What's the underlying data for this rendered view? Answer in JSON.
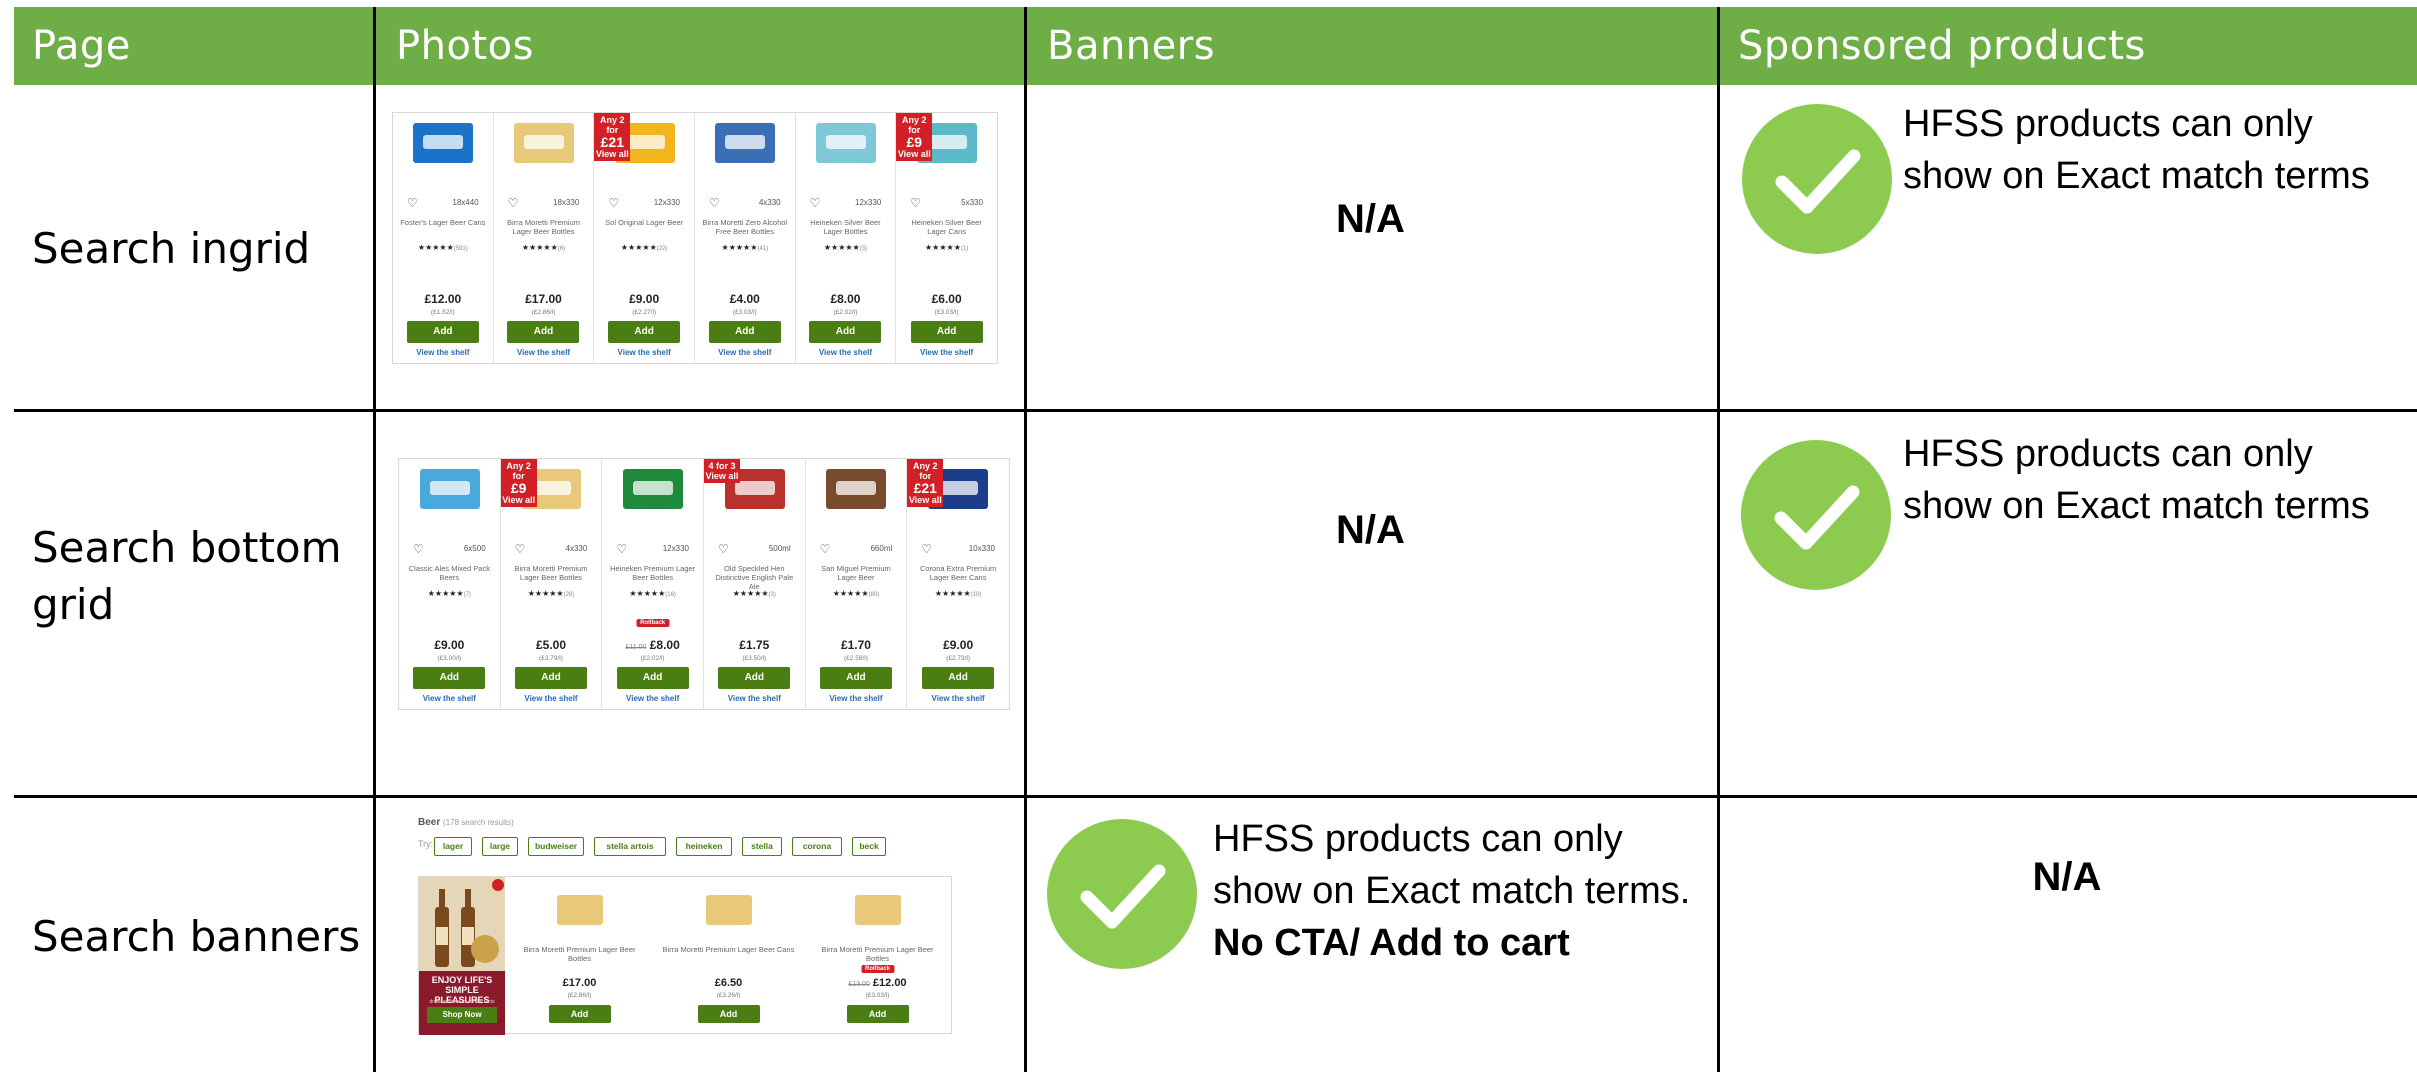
{
  "header": {
    "page": "Page",
    "photos": "Photos",
    "banners": "Banners",
    "sponsored": "Sponsored products"
  },
  "rows": {
    "r1": {
      "label": "Search ingrid",
      "banners": "N/A",
      "sponsored": "HFSS products can only show on Exact match terms"
    },
    "r2": {
      "label": "Search bottom grid",
      "banners": "N/A",
      "sponsored": "HFSS products can only show on Exact match terms"
    },
    "r3": {
      "label": "Search banners",
      "banners_line1": "HFSS products can only show on Exact match terms.",
      "banners_bold": "No CTA/ Add to cart",
      "sponsored": "N/A"
    }
  },
  "grid1": {
    "products": [
      {
        "name": "Foster's Lager Beer Cans",
        "size": "18x440",
        "reviews": "(591)",
        "price": "£12.00",
        "unit": "(£1.52/l)",
        "deal": "",
        "pack_color": "#1a73c9"
      },
      {
        "name": "Birra Moretti Premium Lager Beer Bottles",
        "size": "18x330",
        "reviews": "(6)",
        "price": "£17.00",
        "unit": "(£2.86/l)",
        "deal": "",
        "pack_color": "#e8c97a"
      },
      {
        "name": "Sol Original Lager Beer",
        "size": "12x330",
        "reviews": "(22)",
        "price": "£9.00",
        "unit": "(£2.27/l)",
        "deal": "Any 2 for|£21|View all",
        "pack_color": "#f2b51c"
      },
      {
        "name": "Birra Moretti Zero Alcohol Free Beer Bottles",
        "size": "4x330",
        "reviews": "(41)",
        "price": "£4.00",
        "unit": "(£3.03/l)",
        "deal": "",
        "pack_color": "#3a6fb6"
      },
      {
        "name": "Heineken Silver Beer Lager Bottles",
        "size": "12x330",
        "reviews": "(3)",
        "price": "£8.00",
        "unit": "(£2.02/l)",
        "deal": "",
        "pack_color": "#7fc8d8"
      },
      {
        "name": "Heineken Silver Beer Lager Cans",
        "size": "5x330",
        "reviews": "(1)",
        "price": "£6.00",
        "unit": "(£3.03/l)",
        "deal": "Any 2 for|£9|View all",
        "pack_color": "#5bb9c9"
      }
    ]
  },
  "grid2": {
    "products": [
      {
        "name": "Classic Ales Mixed Pack Beers",
        "size": "6x500",
        "reviews": "(7)",
        "price": "£9.00",
        "unit": "(£3.00/l)",
        "deal": "",
        "pack_color": "#49a9dd"
      },
      {
        "name": "Birra Moretti Premium Lager Beer Bottles",
        "size": "4x330",
        "reviews": "(28)",
        "price": "£5.00",
        "unit": "(£3.79/l)",
        "deal": "Any 2 for|£9|View all",
        "pack_color": "#e8c97a"
      },
      {
        "name": "Heineken Premium Lager Beer Bottles",
        "size": "12x330",
        "reviews": "(16)",
        "price": "£8.00",
        "old": "£11.00",
        "unit": "(£2.02/l)",
        "deal": "",
        "rollback": "Rollback",
        "pack_color": "#1f8a3c"
      },
      {
        "name": "Old Speckled Hen Distinctive English Pale Ale",
        "size": "500ml",
        "reviews": "(3)",
        "price": "£1.75",
        "unit": "(£3.50/l)",
        "deal": "4 for 3|View all",
        "pack_color": "#b8312c"
      },
      {
        "name": "San Miguel Premium Lager Beer",
        "size": "660ml",
        "reviews": "(80)",
        "price": "£1.70",
        "unit": "(£2.58/l)",
        "deal": "",
        "pack_color": "#7a4a2e"
      },
      {
        "name": "Corona Extra Premium Lager Beer Cans",
        "size": "10x330",
        "reviews": "(10)",
        "price": "£9.00",
        "unit": "(£2.73/l)",
        "deal": "Any 2 for|£21|View all",
        "pack_color": "#1b3d8a"
      }
    ]
  },
  "grid_labels": {
    "add": "Add",
    "shelf": "View the shelf",
    "stars": "★★★★★"
  },
  "banner_thumb": {
    "title": "Beer",
    "result_count": "(178 search results)",
    "try": "Try:",
    "chips": [
      "lager",
      "large",
      "budweiser",
      "stella artois",
      "heineken",
      "stella",
      "corona",
      "beck"
    ],
    "promo_text": "ENJOY LIFE'S SIMPLE PLEASURES",
    "promo_small": "drinkaware.co.uk for the facts",
    "shop_now": "Shop Now",
    "products": [
      {
        "name": "Birra Moretti Premium Lager Beer Bottles",
        "price": "£17.00",
        "unit": "(£2.86/l)",
        "old": "",
        "rollback": ""
      },
      {
        "name": "Birra Moretti Premium Lager Beer Cans",
        "price": "£6.50",
        "unit": "(£3.26/l)",
        "old": "",
        "rollback": ""
      },
      {
        "name": "Birra Moretti Premium Lager Beer Bottles",
        "price": "£12.00",
        "unit": "(£3.03/l)",
        "old": "£13.00",
        "rollback": "Rollback"
      }
    ],
    "add": "Add"
  },
  "colors": {
    "header_green": "#6fad47",
    "check_green": "#8ccb4f",
    "button_green": "#4a7d12",
    "deal_red": "#d32027"
  }
}
